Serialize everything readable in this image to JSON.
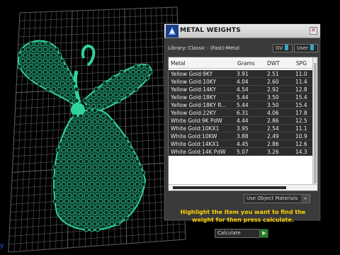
{
  "panel": {
    "title": "METAL WEIGHTS",
    "close_glyph": "×",
    "library_label": "Library: Classic - (Fast)-Metal",
    "gv_label": "GV",
    "user_label": "User"
  },
  "table": {
    "headers": {
      "metal": "Metal",
      "grams": "Grams",
      "dwt": "DWT",
      "spg": "SPG"
    },
    "rows": [
      {
        "metal": "Yellow Gold:9KY",
        "grams": "3.91",
        "dwt": "2.51",
        "spg": "11.0"
      },
      {
        "metal": "Yellow Gold:10KY",
        "grams": "4.04",
        "dwt": "2.60",
        "spg": "11.4"
      },
      {
        "metal": "Yellow Gold:14KY",
        "grams": "4.54",
        "dwt": "2.92",
        "spg": "12.8"
      },
      {
        "metal": "Yellow Gold:18KY",
        "grams": "5.44",
        "dwt": "3.50",
        "spg": "15.4"
      },
      {
        "metal": "Yellow Gold:18KY R...",
        "grams": "5.44",
        "dwt": "3.50",
        "spg": "15.4"
      },
      {
        "metal": "Yellow Gold:22KY",
        "grams": "6.31",
        "dwt": "4.06",
        "spg": "17.8"
      },
      {
        "metal": "White Gold:9K PdW",
        "grams": "4.44",
        "dwt": "2.86",
        "spg": "12.5"
      },
      {
        "metal": "White Gold:10KX1",
        "grams": "3.95",
        "dwt": "2.54",
        "spg": "11.1"
      },
      {
        "metal": "White Gold:10KW",
        "grams": "3.88",
        "dwt": "2.49",
        "spg": "10.9"
      },
      {
        "metal": "White Gold:14KX1",
        "grams": "4.45",
        "dwt": "2.86",
        "spg": "12.6"
      },
      {
        "metal": "White Gold:14K PdW",
        "grams": "5.07",
        "dwt": "3.26",
        "spg": "14.3"
      }
    ]
  },
  "use_object_materials": "Use Object Materials",
  "instructions": "Highlight the item you want to find the weight for then press calculate.",
  "calculate_label": "Calculate",
  "viewport": {
    "axis_label": "y"
  },
  "colors": {
    "model": "#2fd49a",
    "accent": "#ffd400",
    "grid": "#5a5a5a"
  }
}
